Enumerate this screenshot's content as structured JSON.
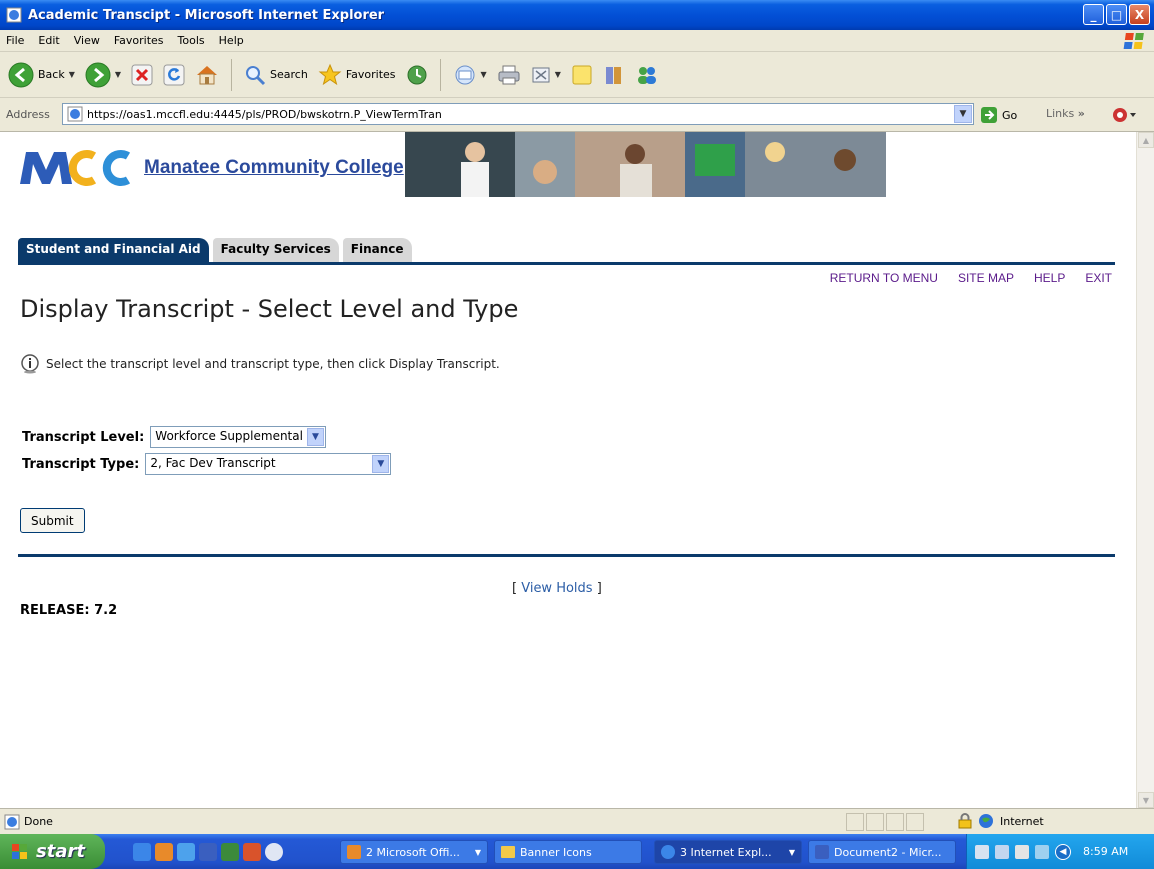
{
  "window": {
    "title": "Academic Transcipt - Microsoft Internet Explorer",
    "min_glyph": "_",
    "max_glyph": "□",
    "close_glyph": "X"
  },
  "menu": [
    "File",
    "Edit",
    "View",
    "Favorites",
    "Tools",
    "Help"
  ],
  "toolbar": {
    "back": "Back",
    "search": "Search",
    "favorites": "Favorites"
  },
  "address": {
    "label": "Address",
    "url": "https://oas1.mccfl.edu:4445/pls/PROD/bwskotrn.P_ViewTermTran",
    "go": "Go",
    "links": "Links",
    "links_chevron": "»"
  },
  "page": {
    "college_name": "Manatee Community College",
    "tabs": [
      {
        "label": "Student and Financial Aid",
        "active": true
      },
      {
        "label": "Faculty Services",
        "active": false
      },
      {
        "label": "Finance",
        "active": false
      }
    ],
    "top_links": [
      "RETURN TO MENU",
      "SITE MAP",
      "HELP",
      "EXIT"
    ],
    "title": "Display Transcript - Select Level and Type",
    "info_text": "Select the transcript level and transcript type, then click Display Transcript.",
    "level_label": "Transcript Level:",
    "level_value": "Workforce Supplemental",
    "type_label": "Transcript Type:",
    "type_value": "2, Fac Dev Transcript",
    "submit_label": "Submit",
    "view_holds_open": "[",
    "view_holds": "View Holds",
    "view_holds_close": "]",
    "release": "RELEASE: 7.2"
  },
  "status": {
    "text": "Done",
    "zone": "Internet"
  },
  "taskbar": {
    "start": "start",
    "tasks": [
      {
        "label": "2 Microsoft Offi...",
        "active": false
      },
      {
        "label": "Banner Icons",
        "active": false
      },
      {
        "label": "3 Internet Expl...",
        "active": true
      },
      {
        "label": "Document2 - Micr...",
        "active": false
      }
    ],
    "clock": "8:59 AM"
  },
  "colors": {
    "tab_active": "#0b3a6b",
    "link_purple": "#5a1a8a",
    "college_blue": "#2b4a9c"
  }
}
